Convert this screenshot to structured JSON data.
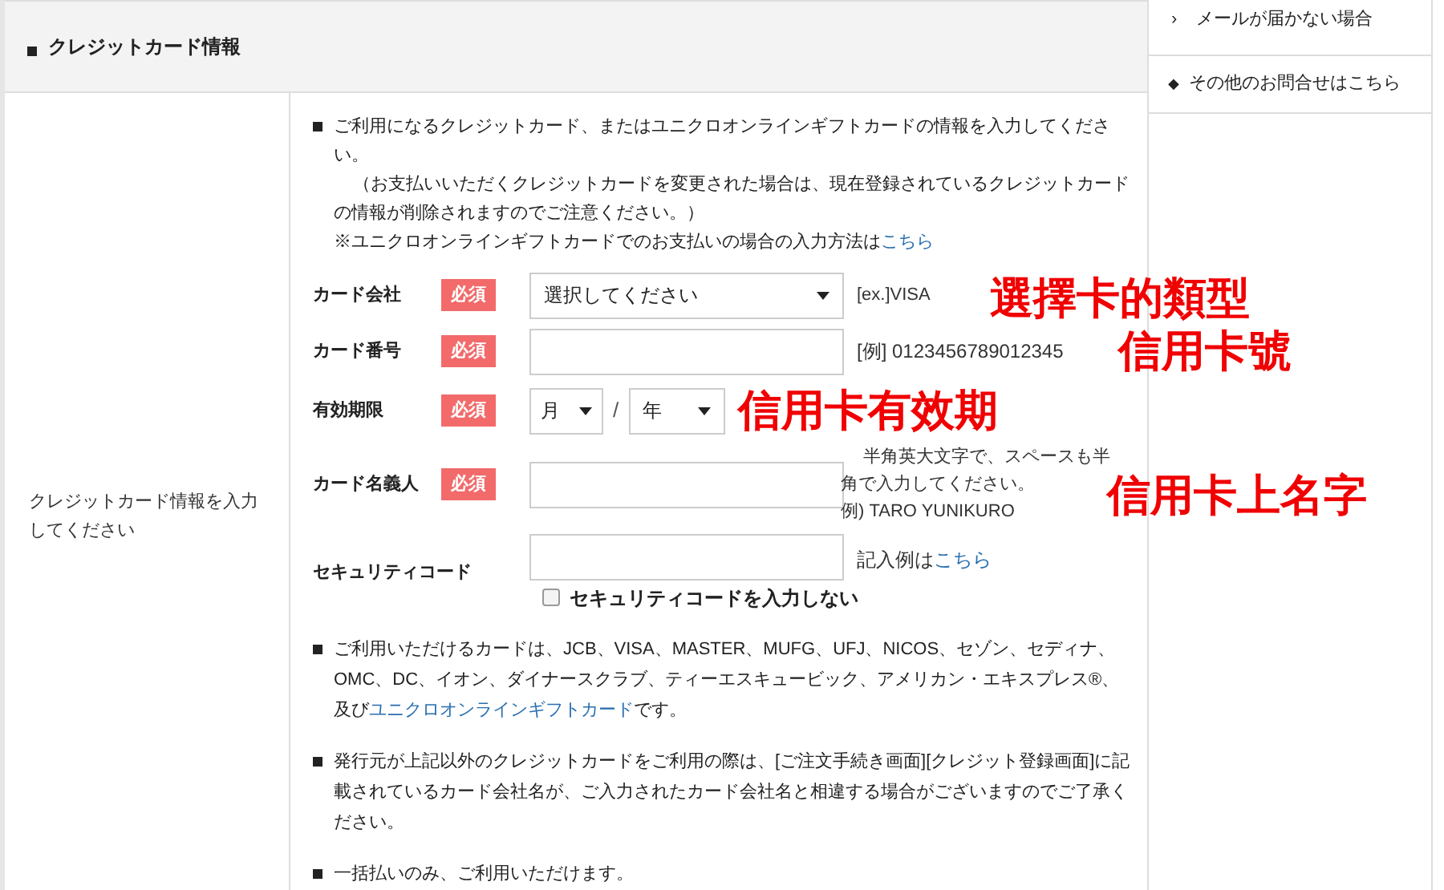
{
  "section_title": "クレジットカード情報",
  "side_label": "クレジットカード情報を入力してください",
  "intro": {
    "lead": "ご利用になるクレジットカード、またはユニクロオンラインギフトカードの情報を入力してください。",
    "note": "（お支払いいただくクレジットカードを変更された場合は、現在登録されているクレジットカードの情報が削除されますのでご注意ください。）",
    "gift_text": "※ユニクロオンラインギフトカードでのお支払いの場合の入力方法は",
    "gift_link": "こちら"
  },
  "fields": [
    {
      "kind": "select",
      "label": "カード会社",
      "required": true,
      "badge": "必須",
      "value": "選択してください",
      "hint": "[ex.]VISA"
    },
    {
      "kind": "input",
      "label": "カード番号",
      "required": true,
      "badge": "必須",
      "hint": "[例] 0123456789012345"
    },
    {
      "kind": "expiry",
      "label": "有効期限",
      "required": true,
      "badge": "必須",
      "month": "月",
      "separator": "/",
      "year": "年"
    },
    {
      "kind": "name",
      "label": "カード名義人",
      "required": true,
      "badge": "必須",
      "hint": "半角英大文字で、スペースも半角で入力してください。",
      "example": "例) TARO YUNIKURO"
    },
    {
      "kind": "security",
      "label": "セキュリティコード",
      "required": false,
      "hint": "記入例は",
      "hint_link": "こちら",
      "checkbox": {
        "label": "セキュリティコードを入力しない",
        "checked": false
      }
    }
  ],
  "notes": [
    {
      "before": "ご利用いただけるカードは、JCB、VISA、MASTER、MUFG、UFJ、NICOS、セゾン、セディナ、OMC、DC、イオン、ダイナースクラブ、ティーエスキュービック、アメリカン・エキスプレス®、及び",
      "link": "ユニクロオンラインギフトカード",
      "after": "です。"
    },
    {
      "before": "発行元が上記以外のクレジットカードをご利用の際は、[ご注文手続き画面][クレジット登録画面]に記載されているカード会社名が、ご入力されたカード会社名と相違する場合がございますのでご了承ください。"
    },
    {
      "before": "一括払いのみ、ご利用いただけます。"
    }
  ],
  "sidebar": [
    {
      "kind": "arrow",
      "marker": "›",
      "label": "メールが届かない場合"
    },
    {
      "kind": "diamond",
      "marker": "◆",
      "label": "その他のお問合せはこちら"
    }
  ],
  "annotations": [
    {
      "text": "選擇卡的類型"
    },
    {
      "text": "信用卡號"
    },
    {
      "text": "信用卡有效期"
    },
    {
      "text": "信用卡上名字"
    }
  ]
}
